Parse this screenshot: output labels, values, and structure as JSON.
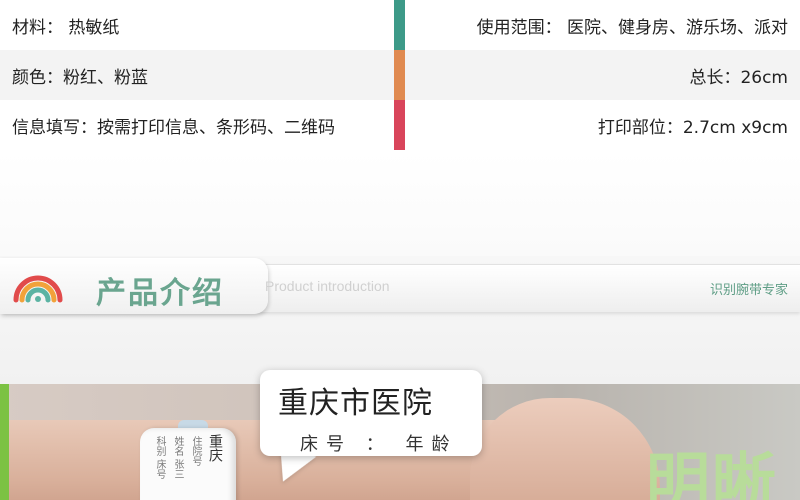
{
  "specs": {
    "rows": [
      {
        "left": "材料： 热敏纸",
        "right": "使用范围： 医院、健身房、游乐场、派对",
        "bar_color": "#3d9a88"
      },
      {
        "left": "颜色：粉红、粉蓝",
        "right": "总长：26cm",
        "bar_color": "#e08a50"
      },
      {
        "left": "信息填写：按需打印信息、条形码、二维码",
        "right": "打印部位：2.7cm x9cm",
        "bar_color": "#d9455b"
      }
    ]
  },
  "section": {
    "title": "产品介绍",
    "subtitle": "Product introduction",
    "tag": "识别腕带专家",
    "logo_icon": "rainbow-arc-logo-icon"
  },
  "photo": {
    "bubble_title": "重庆市医院",
    "bubble_line": "床号 ： 年龄",
    "band_col1": "科别 床号",
    "band_col2": "姓名 张三",
    "band_col3": "住院号",
    "band_col4": "重庆",
    "big_word": "明晰",
    "accent_color": "#7cc243"
  }
}
